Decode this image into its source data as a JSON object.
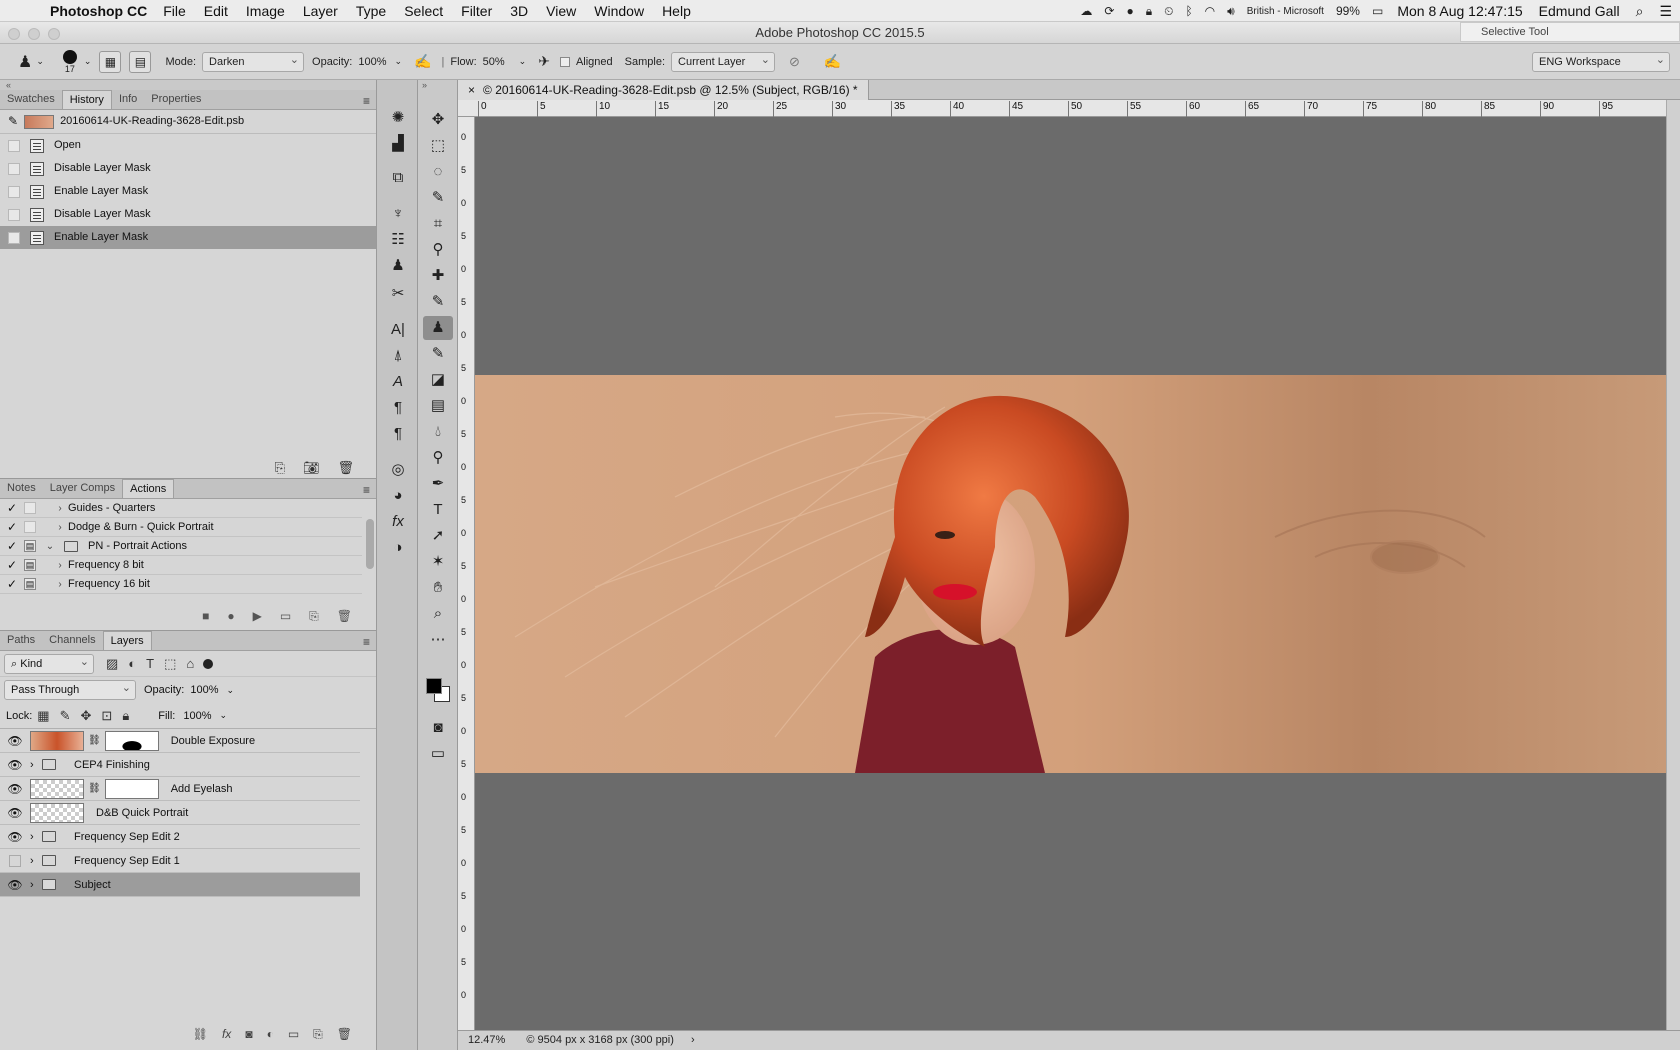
{
  "menubar": {
    "app_name": "Photoshop CC",
    "items": [
      "File",
      "Edit",
      "Image",
      "Layer",
      "Type",
      "Select",
      "Filter",
      "3D",
      "View",
      "Window",
      "Help"
    ],
    "input_source": "British - Microsoft",
    "battery": "99%",
    "datetime": "Mon 8 Aug  12:47:15",
    "user": "Edmund Gall"
  },
  "window": {
    "title": "Adobe Photoshop CC 2015.5",
    "selective_tool": "Selective Tool"
  },
  "options": {
    "brush_size": "17",
    "mode_label": "Mode:",
    "mode_value": "Darken",
    "opacity_label": "Opacity:",
    "opacity_value": "100%",
    "flow_label": "Flow:",
    "flow_value": "50%",
    "aligned_label": "Aligned",
    "sample_label": "Sample:",
    "sample_value": "Current Layer",
    "workspace": "ENG Workspace"
  },
  "history_panel": {
    "tabs": [
      "Swatches",
      "History",
      "Info",
      "Properties"
    ],
    "active_tab": "History",
    "snapshot": "20160614-UK-Reading-3628-Edit.psb",
    "items": [
      "Open",
      "Disable Layer Mask",
      "Enable Layer Mask",
      "Disable Layer Mask",
      "Enable Layer Mask"
    ]
  },
  "actions_panel": {
    "tabs": [
      "Notes",
      "Layer Comps",
      "Actions"
    ],
    "active_tab": "Actions",
    "items": [
      {
        "label": "Guides - Quarters",
        "indent": 1,
        "expanded": false,
        "box": false
      },
      {
        "label": "Dodge & Burn - Quick Portrait",
        "indent": 1,
        "expanded": false,
        "box": false
      },
      {
        "label": "PN - Portrait Actions",
        "indent": 0,
        "expanded": true,
        "box": true
      },
      {
        "label": "Frequency 8 bit",
        "indent": 1,
        "expanded": false,
        "box": true
      },
      {
        "label": "Frequency 16 bit",
        "indent": 1,
        "expanded": false,
        "box": true
      }
    ]
  },
  "layers_panel": {
    "tabs": [
      "Paths",
      "Channels",
      "Layers"
    ],
    "active_tab": "Layers",
    "filter": "Kind",
    "blend_mode": "Pass Through",
    "opacity_label": "Opacity:",
    "opacity_value": "100%",
    "lock_label": "Lock:",
    "fill_label": "Fill:",
    "fill_value": "100%",
    "layers": [
      {
        "name": "Double Exposure",
        "type": "image-mask",
        "visible": true
      },
      {
        "name": "CEP4 Finishing",
        "type": "group",
        "visible": true
      },
      {
        "name": "Add Eyelash",
        "type": "empty-mask",
        "visible": true
      },
      {
        "name": "D&B Quick Portrait",
        "type": "layer",
        "visible": true
      },
      {
        "name": "Frequency Sep Edit 2",
        "type": "group",
        "visible": true
      },
      {
        "name": "Frequency Sep Edit 1",
        "type": "group",
        "visible": false
      },
      {
        "name": "Subject",
        "type": "group",
        "visible": true
      }
    ]
  },
  "document": {
    "tab_title": "© 20160614-UK-Reading-3628-Edit.psb @ 12.5% (Subject, RGB/16) *",
    "zoom": "12.47%",
    "info": "© 9504 px x 3168 px (300 ppi)",
    "ruler_labels": [
      "0",
      "5",
      "10",
      "15",
      "20",
      "25",
      "30",
      "35",
      "40",
      "45",
      "50",
      "55",
      "60",
      "65",
      "70",
      "75",
      "80",
      "85",
      "90",
      "95"
    ],
    "vruler_labels": [
      "0",
      "5",
      "0",
      "5",
      "0",
      "5",
      "0",
      "5",
      "0",
      "5",
      "0",
      "5",
      "0",
      "5",
      "0",
      "5",
      "0",
      "5",
      "0",
      "5",
      "0",
      "5",
      "0",
      "5",
      "0",
      "5",
      "0"
    ]
  },
  "colors": {
    "skin_bg": "#d6a886",
    "hair": "#d7572a",
    "canvas": "#6b6b6b",
    "panel": "#d6d6d6"
  }
}
